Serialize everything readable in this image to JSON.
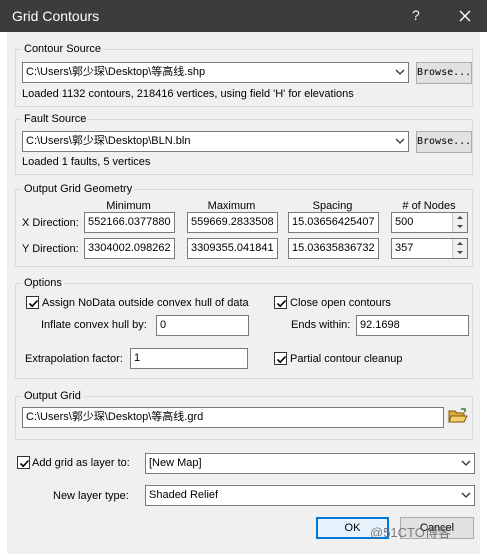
{
  "window": {
    "title": "Grid Contours",
    "help": "?",
    "close": "✕"
  },
  "contour_source": {
    "legend": "Contour Source",
    "path": "C:\\Users\\郭少琛\\Desktop\\等高线.shp",
    "browse_label": "Browse...",
    "status": "Loaded 1132 contours, 218416 vertices, using field 'H' for elevations"
  },
  "fault_source": {
    "legend": "Fault Source",
    "path": "C:\\Users\\郭少琛\\Desktop\\BLN.bln",
    "browse_label": "Browse...",
    "status": "Loaded 1 faults, 5 vertices"
  },
  "geometry": {
    "legend": "Output Grid Geometry",
    "headers": {
      "minimum": "Minimum",
      "maximum": "Maximum",
      "spacing": "Spacing",
      "nodes": "# of Nodes"
    },
    "x": {
      "label": "X Direction:",
      "min": "552166.0377880",
      "max": "559669.2833508",
      "spacing": "15.03656425407",
      "nodes": "500"
    },
    "y": {
      "label": "Y Direction:",
      "min": "3304002.098262",
      "max": "3309355.041841",
      "spacing": "15.03635836732",
      "nodes": "357"
    }
  },
  "options": {
    "legend": "Options",
    "assign_nodata": {
      "label": "Assign NoData outside convex hull of data",
      "checked": true
    },
    "inflate": {
      "label": "Inflate convex hull by:",
      "value": "0"
    },
    "extrapolation": {
      "label": "Extrapolation factor:",
      "value": "1"
    },
    "close_open": {
      "label": "Close open contours",
      "checked": true
    },
    "ends_within": {
      "label": "Ends within:",
      "value": "92.1698"
    },
    "partial_cleanup": {
      "label": "Partial contour cleanup",
      "checked": true
    }
  },
  "output_grid": {
    "legend": "Output Grid",
    "path": "C:\\Users\\郭少琛\\Desktop\\等高线.grd"
  },
  "add_layer": {
    "label": "Add grid as layer to:",
    "checked": true,
    "value": "[New Map]"
  },
  "layer_type": {
    "label": "New layer type:",
    "value": "Shaded Relief"
  },
  "buttons": {
    "ok": "OK",
    "cancel": "Cancel"
  },
  "watermark": "@51CTO博客"
}
